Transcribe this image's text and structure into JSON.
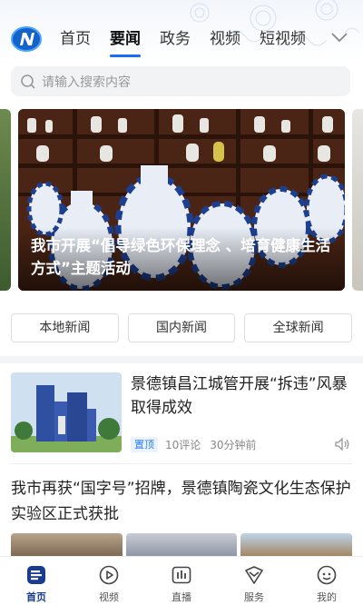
{
  "header": {
    "tabs": [
      {
        "label": "首页",
        "active": false
      },
      {
        "label": "要闻",
        "active": true
      },
      {
        "label": "政务",
        "active": false
      },
      {
        "label": "视频",
        "active": false
      },
      {
        "label": "短视频",
        "active": false
      }
    ],
    "more_icon": "chevron-down-icon",
    "logo_icon": "app-logo-icon"
  },
  "search": {
    "placeholder": "请输入搜索内容",
    "icon": "search-icon"
  },
  "banner": {
    "caption": "我市开展“倡导绿色环保理念 、培育健康生活方式”主题活动"
  },
  "categories": [
    "本地新闻",
    "国内新闻",
    "全球新闻"
  ],
  "articles": [
    {
      "title": "景德镇昌江城管开展“拆违”风暴取得成效",
      "badge": "置顶",
      "comments": "10评论",
      "time": "30分钟前",
      "audio_icon": "speaker-icon"
    },
    {
      "title": "我市再获“国字号”招牌，景德镇陶瓷文化生态保护实验区正式获批"
    }
  ],
  "bottom_nav": [
    {
      "label": "首页",
      "icon": "home-icon",
      "active": true
    },
    {
      "label": "视频",
      "icon": "play-icon",
      "active": false
    },
    {
      "label": "直播",
      "icon": "live-icon",
      "active": false
    },
    {
      "label": "服务",
      "icon": "service-icon",
      "active": false
    },
    {
      "label": "我的",
      "icon": "profile-icon",
      "active": false
    }
  ],
  "colors": {
    "accent": "#1a6ef5",
    "badge": "#2f7ef7",
    "nav_active": "#1a3c8c"
  }
}
